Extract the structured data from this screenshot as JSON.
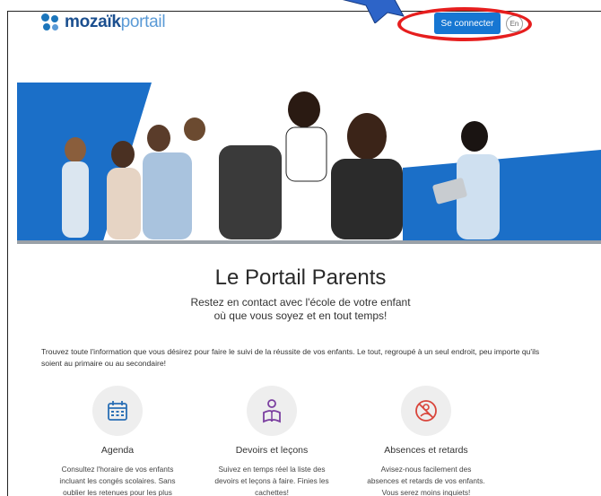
{
  "header": {
    "logo_bold": "mozaïk",
    "logo_light": "portail",
    "connect_label": "Se connecter",
    "lang_label": "En"
  },
  "colors": {
    "primary": "#1676d2",
    "annotation": "#e61e1e",
    "logo_dark": "#1b4f8f"
  },
  "hero": {
    "title": "Le Portail Parents",
    "subtitle_line1": "Restez en contact avec l'école de votre enfant",
    "subtitle_line2": "où que vous soyez et en tout temps!"
  },
  "intro": "Trouvez toute l'information que vous désirez pour faire le suivi de la réussite de vos enfants. Le tout, regroupé à un seul endroit, peu importe qu'ils soient au primaire ou au secondaire!",
  "features": [
    {
      "icon": "calendar-icon",
      "title": "Agenda",
      "desc1": "Consultez l'horaire de vos enfants",
      "desc2": "incluant les congés scolaires. Sans",
      "desc3": "oublier les retenues pour les plus"
    },
    {
      "icon": "person-reading-icon",
      "title": "Devoirs et leçons",
      "desc1": "Suivez en temps réel la liste des",
      "desc2": "devoirs et leçons à faire. Finies les",
      "desc3": "cachettes!"
    },
    {
      "icon": "absence-icon",
      "title": "Absences et retards",
      "desc1": "Avisez-nous facilement des",
      "desc2": "absences et retards de vos enfants.",
      "desc3": "Vous serez moins inquiets!"
    }
  ]
}
